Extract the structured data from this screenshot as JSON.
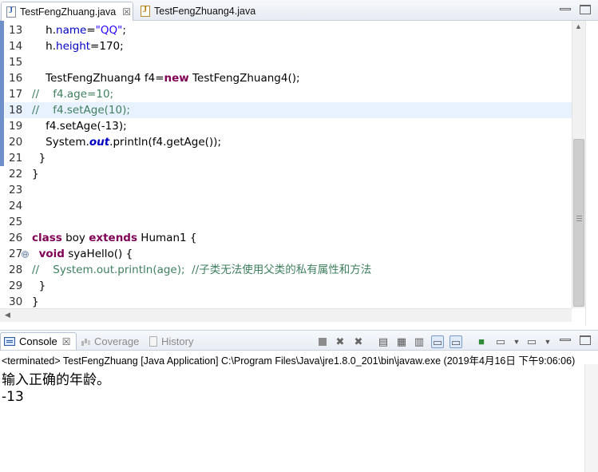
{
  "editor_tabs": [
    {
      "label": "TestFengZhuang.java",
      "active": true,
      "close": "☒"
    },
    {
      "label": "TestFengZhuang4.java",
      "active": false
    }
  ],
  "code_lines": [
    {
      "num": "13",
      "highlight": false,
      "tokens": [
        {
          "t": "    "
        },
        {
          "t": "h",
          "c": "plain"
        },
        {
          "t": ".",
          "c": "plain"
        },
        {
          "t": "name",
          "c": "fld"
        },
        {
          "t": "=",
          "c": "plain"
        },
        {
          "t": "\"QQ\"",
          "c": "str"
        },
        {
          "t": ";"
        }
      ]
    },
    {
      "num": "14",
      "highlight": false,
      "tokens": [
        {
          "t": "    h."
        },
        {
          "t": "height",
          "c": "fld"
        },
        {
          "t": "=170;"
        }
      ]
    },
    {
      "num": "15",
      "highlight": false,
      "tokens": []
    },
    {
      "num": "16",
      "highlight": false,
      "tokens": [
        {
          "t": "    TestFengZhuang4 f4="
        },
        {
          "t": "new",
          "c": "kw"
        },
        {
          "t": " TestFengZhuang4();"
        }
      ]
    },
    {
      "num": "17",
      "highlight": false,
      "tokens": [
        {
          "t": "//    f4.age=10;",
          "c": "cmt"
        }
      ]
    },
    {
      "num": "18",
      "highlight": true,
      "tokens": [
        {
          "t": "//    f4.setAge(10);",
          "c": "cmt"
        }
      ]
    },
    {
      "num": "19",
      "highlight": false,
      "tokens": [
        {
          "t": "    f4.setAge(-13);"
        }
      ]
    },
    {
      "num": "20",
      "highlight": false,
      "tokens": [
        {
          "t": "    System."
        },
        {
          "t": "out",
          "c": "sfld"
        },
        {
          "t": ".println(f4.getAge());"
        }
      ]
    },
    {
      "num": "21",
      "highlight": false,
      "tokens": [
        {
          "t": "  }"
        }
      ]
    },
    {
      "num": "22",
      "highlight": false,
      "tokens": [
        {
          "t": "}"
        }
      ]
    },
    {
      "num": "23",
      "highlight": false,
      "tokens": []
    },
    {
      "num": "24",
      "highlight": false,
      "tokens": []
    },
    {
      "num": "25",
      "highlight": false,
      "tokens": []
    },
    {
      "num": "26",
      "highlight": false,
      "tokens": [
        {
          "t": "class",
          "c": "kw"
        },
        {
          "t": " boy "
        },
        {
          "t": "extends",
          "c": "kw"
        },
        {
          "t": " Human1 {"
        }
      ]
    },
    {
      "num": "27",
      "highlight": false,
      "fold": "⊖",
      "tokens": [
        {
          "t": "  "
        },
        {
          "t": "void",
          "c": "kw"
        },
        {
          "t": " syaHello() {"
        }
      ]
    },
    {
      "num": "28",
      "highlight": false,
      "tokens": [
        {
          "t": "//    System.out.println(age);  //子类无法使用父类的私有属性和方法",
          "c": "cmt"
        }
      ]
    },
    {
      "num": "29",
      "highlight": false,
      "tokens": [
        {
          "t": "  }"
        }
      ]
    },
    {
      "num": "30",
      "highlight": false,
      "tokens": [
        {
          "t": "}"
        }
      ]
    }
  ],
  "console": {
    "tabs": [
      {
        "label": "Console",
        "close": "☒"
      },
      {
        "label": "Coverage"
      },
      {
        "label": "History"
      }
    ],
    "launch_line": "<terminated> TestFengZhuang [Java Application] C:\\Program Files\\Java\\jre1.8.0_201\\bin\\javaw.exe (2019年4月16日 下午9:06:06)",
    "output": [
      "输入正确的年龄。",
      "-13"
    ]
  },
  "colors": {
    "keyword": "#7f0055",
    "string": "#2a00ff",
    "field": "#0000c0",
    "comment": "#3f7f5f",
    "current_line": "#e8f2fe"
  },
  "icons": [
    "java-file-icon",
    "close-icon",
    "minimize-icon",
    "maximize-icon",
    "console-icon",
    "coverage-icon",
    "history-icon",
    "terminate-icon",
    "remove-launch-icon",
    "remove-all-icon",
    "scroll-lock-icon",
    "word-wrap-icon",
    "show-stdout-icon",
    "show-stderr-icon",
    "pin-console-icon",
    "display-console-icon",
    "open-console-icon"
  ]
}
